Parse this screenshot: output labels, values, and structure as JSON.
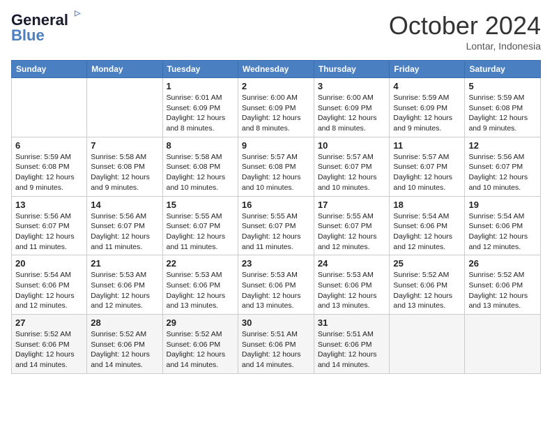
{
  "header": {
    "logo_line1": "General",
    "logo_line2": "Blue",
    "month": "October 2024",
    "location": "Lontar, Indonesia"
  },
  "days_of_week": [
    "Sunday",
    "Monday",
    "Tuesday",
    "Wednesday",
    "Thursday",
    "Friday",
    "Saturday"
  ],
  "weeks": [
    [
      {
        "day": "",
        "sunrise": "",
        "sunset": "",
        "daylight": ""
      },
      {
        "day": "",
        "sunrise": "",
        "sunset": "",
        "daylight": ""
      },
      {
        "day": "1",
        "sunrise": "Sunrise: 6:01 AM",
        "sunset": "Sunset: 6:09 PM",
        "daylight": "Daylight: 12 hours and 8 minutes."
      },
      {
        "day": "2",
        "sunrise": "Sunrise: 6:00 AM",
        "sunset": "Sunset: 6:09 PM",
        "daylight": "Daylight: 12 hours and 8 minutes."
      },
      {
        "day": "3",
        "sunrise": "Sunrise: 6:00 AM",
        "sunset": "Sunset: 6:09 PM",
        "daylight": "Daylight: 12 hours and 8 minutes."
      },
      {
        "day": "4",
        "sunrise": "Sunrise: 5:59 AM",
        "sunset": "Sunset: 6:09 PM",
        "daylight": "Daylight: 12 hours and 9 minutes."
      },
      {
        "day": "5",
        "sunrise": "Sunrise: 5:59 AM",
        "sunset": "Sunset: 6:08 PM",
        "daylight": "Daylight: 12 hours and 9 minutes."
      }
    ],
    [
      {
        "day": "6",
        "sunrise": "Sunrise: 5:59 AM",
        "sunset": "Sunset: 6:08 PM",
        "daylight": "Daylight: 12 hours and 9 minutes."
      },
      {
        "day": "7",
        "sunrise": "Sunrise: 5:58 AM",
        "sunset": "Sunset: 6:08 PM",
        "daylight": "Daylight: 12 hours and 9 minutes."
      },
      {
        "day": "8",
        "sunrise": "Sunrise: 5:58 AM",
        "sunset": "Sunset: 6:08 PM",
        "daylight": "Daylight: 12 hours and 10 minutes."
      },
      {
        "day": "9",
        "sunrise": "Sunrise: 5:57 AM",
        "sunset": "Sunset: 6:08 PM",
        "daylight": "Daylight: 12 hours and 10 minutes."
      },
      {
        "day": "10",
        "sunrise": "Sunrise: 5:57 AM",
        "sunset": "Sunset: 6:07 PM",
        "daylight": "Daylight: 12 hours and 10 minutes."
      },
      {
        "day": "11",
        "sunrise": "Sunrise: 5:57 AM",
        "sunset": "Sunset: 6:07 PM",
        "daylight": "Daylight: 12 hours and 10 minutes."
      },
      {
        "day": "12",
        "sunrise": "Sunrise: 5:56 AM",
        "sunset": "Sunset: 6:07 PM",
        "daylight": "Daylight: 12 hours and 10 minutes."
      }
    ],
    [
      {
        "day": "13",
        "sunrise": "Sunrise: 5:56 AM",
        "sunset": "Sunset: 6:07 PM",
        "daylight": "Daylight: 12 hours and 11 minutes."
      },
      {
        "day": "14",
        "sunrise": "Sunrise: 5:56 AM",
        "sunset": "Sunset: 6:07 PM",
        "daylight": "Daylight: 12 hours and 11 minutes."
      },
      {
        "day": "15",
        "sunrise": "Sunrise: 5:55 AM",
        "sunset": "Sunset: 6:07 PM",
        "daylight": "Daylight: 12 hours and 11 minutes."
      },
      {
        "day": "16",
        "sunrise": "Sunrise: 5:55 AM",
        "sunset": "Sunset: 6:07 PM",
        "daylight": "Daylight: 12 hours and 11 minutes."
      },
      {
        "day": "17",
        "sunrise": "Sunrise: 5:55 AM",
        "sunset": "Sunset: 6:07 PM",
        "daylight": "Daylight: 12 hours and 12 minutes."
      },
      {
        "day": "18",
        "sunrise": "Sunrise: 5:54 AM",
        "sunset": "Sunset: 6:06 PM",
        "daylight": "Daylight: 12 hours and 12 minutes."
      },
      {
        "day": "19",
        "sunrise": "Sunrise: 5:54 AM",
        "sunset": "Sunset: 6:06 PM",
        "daylight": "Daylight: 12 hours and 12 minutes."
      }
    ],
    [
      {
        "day": "20",
        "sunrise": "Sunrise: 5:54 AM",
        "sunset": "Sunset: 6:06 PM",
        "daylight": "Daylight: 12 hours and 12 minutes."
      },
      {
        "day": "21",
        "sunrise": "Sunrise: 5:53 AM",
        "sunset": "Sunset: 6:06 PM",
        "daylight": "Daylight: 12 hours and 12 minutes."
      },
      {
        "day": "22",
        "sunrise": "Sunrise: 5:53 AM",
        "sunset": "Sunset: 6:06 PM",
        "daylight": "Daylight: 12 hours and 13 minutes."
      },
      {
        "day": "23",
        "sunrise": "Sunrise: 5:53 AM",
        "sunset": "Sunset: 6:06 PM",
        "daylight": "Daylight: 12 hours and 13 minutes."
      },
      {
        "day": "24",
        "sunrise": "Sunrise: 5:53 AM",
        "sunset": "Sunset: 6:06 PM",
        "daylight": "Daylight: 12 hours and 13 minutes."
      },
      {
        "day": "25",
        "sunrise": "Sunrise: 5:52 AM",
        "sunset": "Sunset: 6:06 PM",
        "daylight": "Daylight: 12 hours and 13 minutes."
      },
      {
        "day": "26",
        "sunrise": "Sunrise: 5:52 AM",
        "sunset": "Sunset: 6:06 PM",
        "daylight": "Daylight: 12 hours and 13 minutes."
      }
    ],
    [
      {
        "day": "27",
        "sunrise": "Sunrise: 5:52 AM",
        "sunset": "Sunset: 6:06 PM",
        "daylight": "Daylight: 12 hours and 14 minutes."
      },
      {
        "day": "28",
        "sunrise": "Sunrise: 5:52 AM",
        "sunset": "Sunset: 6:06 PM",
        "daylight": "Daylight: 12 hours and 14 minutes."
      },
      {
        "day": "29",
        "sunrise": "Sunrise: 5:52 AM",
        "sunset": "Sunset: 6:06 PM",
        "daylight": "Daylight: 12 hours and 14 minutes."
      },
      {
        "day": "30",
        "sunrise": "Sunrise: 5:51 AM",
        "sunset": "Sunset: 6:06 PM",
        "daylight": "Daylight: 12 hours and 14 minutes."
      },
      {
        "day": "31",
        "sunrise": "Sunrise: 5:51 AM",
        "sunset": "Sunset: 6:06 PM",
        "daylight": "Daylight: 12 hours and 14 minutes."
      },
      {
        "day": "",
        "sunrise": "",
        "sunset": "",
        "daylight": ""
      },
      {
        "day": "",
        "sunrise": "",
        "sunset": "",
        "daylight": ""
      }
    ]
  ]
}
